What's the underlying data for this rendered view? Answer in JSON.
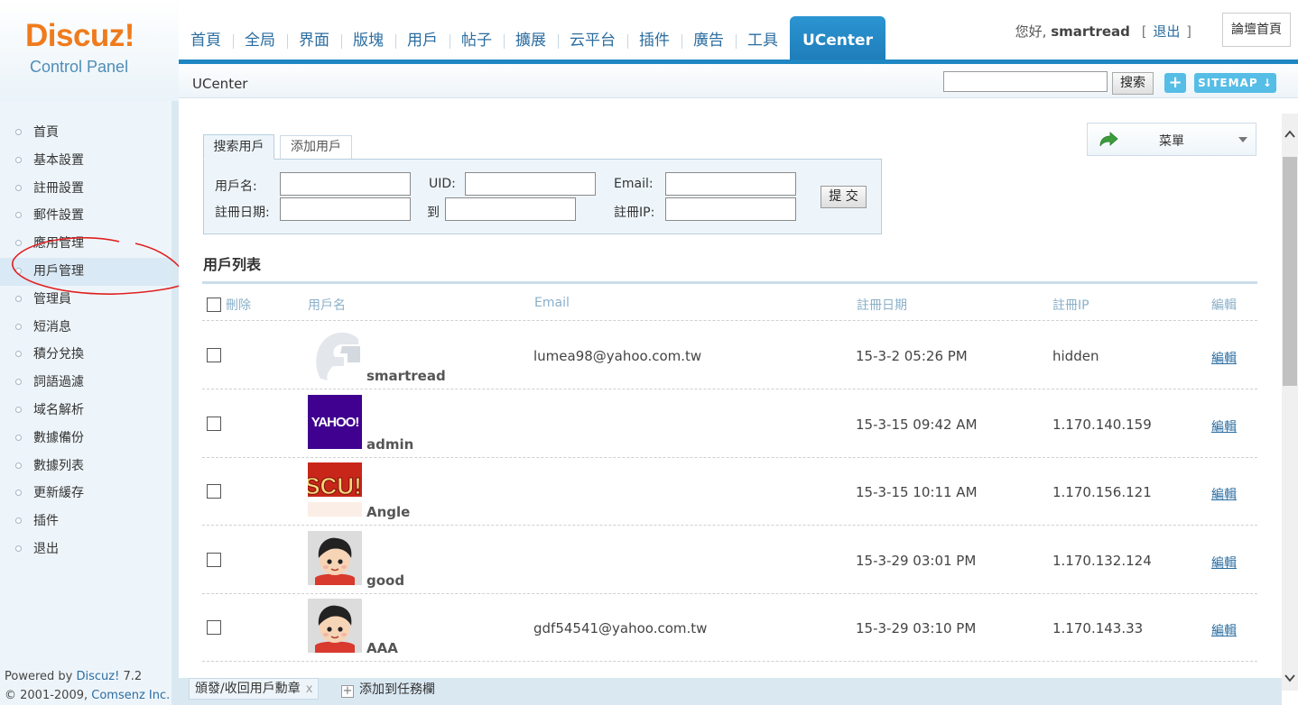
{
  "logo": {
    "name": "Discuz!",
    "subtitle": "Control Panel"
  },
  "topnav": [
    {
      "label": "首頁",
      "name": "nav-home"
    },
    {
      "label": "全局",
      "name": "nav-global"
    },
    {
      "label": "界面",
      "name": "nav-interface"
    },
    {
      "label": "版塊",
      "name": "nav-forums"
    },
    {
      "label": "用戶",
      "name": "nav-users"
    },
    {
      "label": "帖子",
      "name": "nav-posts"
    },
    {
      "label": "擴展",
      "name": "nav-extend"
    },
    {
      "label": "云平台",
      "name": "nav-cloud"
    },
    {
      "label": "插件",
      "name": "nav-plugins"
    },
    {
      "label": "廣告",
      "name": "nav-ads"
    },
    {
      "label": "工具",
      "name": "nav-tools"
    },
    {
      "label": "UCenter",
      "name": "nav-ucenter",
      "active": true
    }
  ],
  "user": {
    "greeting": "您好,",
    "username": "smartread",
    "bracket_open": "[",
    "logout": "退出",
    "bracket_close": "]",
    "forum_home": "論壇首頁"
  },
  "subbar": {
    "title": "UCenter",
    "search_value": "",
    "search_button": "搜索",
    "plus": "+",
    "sitemap": "SITEMAP ↓"
  },
  "sidebar": {
    "items": [
      {
        "label": "首頁",
        "name": "side-home"
      },
      {
        "label": "基本設置",
        "name": "side-basic-settings"
      },
      {
        "label": "註冊設置",
        "name": "side-register-settings"
      },
      {
        "label": "郵件設置",
        "name": "side-mail-settings"
      },
      {
        "label": "應用管理",
        "name": "side-apps"
      },
      {
        "label": "用戶管理",
        "name": "side-users",
        "active": true
      },
      {
        "label": "管理員",
        "name": "side-admins"
      },
      {
        "label": "短消息",
        "name": "side-pm"
      },
      {
        "label": "積分兌換",
        "name": "side-credits"
      },
      {
        "label": "詞語過濾",
        "name": "side-badwords"
      },
      {
        "label": "域名解析",
        "name": "side-domains"
      },
      {
        "label": "數據備份",
        "name": "side-backup"
      },
      {
        "label": "數據列表",
        "name": "side-datalist"
      },
      {
        "label": "更新緩存",
        "name": "side-cache"
      },
      {
        "label": "插件",
        "name": "side-plugins"
      },
      {
        "label": "退出",
        "name": "side-logout"
      }
    ],
    "powered_prefix": "Powered by ",
    "powered_brand": "Discuz!",
    "powered_version": " 7.2",
    "copyright_prefix": "© 2001-2009, ",
    "copyright_company": "Comsenz Inc."
  },
  "menu_dropdown": {
    "label": "菜單"
  },
  "tabs": {
    "search": "搜索用戶",
    "add": "添加用戶"
  },
  "search_form": {
    "username_label": "用戶名:",
    "uid_label": "UID:",
    "email_label": "Email:",
    "regdate_label": "註冊日期:",
    "to_label": "到",
    "regip_label": "註冊IP:",
    "submit": "提 交",
    "username_value": "",
    "uid_value": "",
    "email_value": "",
    "date_from_value": "",
    "date_to_value": "",
    "regip_value": ""
  },
  "list": {
    "title": "用戶列表",
    "headers": {
      "delete": "刪除",
      "username": "用戶名",
      "email": "Email",
      "regdate": "註冊日期",
      "regip": "註冊IP",
      "edit": "編輯"
    },
    "rows": [
      {
        "username": "smartread",
        "email": "lumea98@yahoo.com.tw",
        "regdate": "15-3-2 05:26 PM",
        "regip": "hidden",
        "edit": "編輯",
        "avatar": "default-avatar"
      },
      {
        "username": "admin",
        "email": "",
        "regdate": "15-3-15 09:42 AM",
        "regip": "1.170.140.159",
        "edit": "編輯",
        "avatar": "yahoo-logo-avatar",
        "avatar_text": "YAHOO!"
      },
      {
        "username": "Angle",
        "email": "",
        "regdate": "15-3-15 10:11 AM",
        "regip": "1.170.156.121",
        "edit": "編輯",
        "avatar": "discuz-logo-avatar",
        "avatar_text": "SCU!"
      },
      {
        "username": "good",
        "email": "",
        "regdate": "15-3-29 03:01 PM",
        "regip": "1.170.132.124",
        "edit": "編輯",
        "avatar": "cartoon-boy-avatar"
      },
      {
        "username": "AAA",
        "email": "gdf54541@yahoo.com.tw",
        "regdate": "15-3-29 03:10 PM",
        "regip": "1.170.143.33",
        "edit": "編輯",
        "avatar": "cartoon-boy-avatar"
      }
    ]
  },
  "taskbar": {
    "task": "頒發/收回用戶勳章",
    "close": "x",
    "add_label": "添加到任務欄",
    "add_icon": "+"
  },
  "colors": {
    "accent": "#1e87c3",
    "logo": "#f07b1c",
    "link": "#2b6da0",
    "sidebar_bg": "#eef5fa",
    "yahoo_purple": "#400090"
  }
}
